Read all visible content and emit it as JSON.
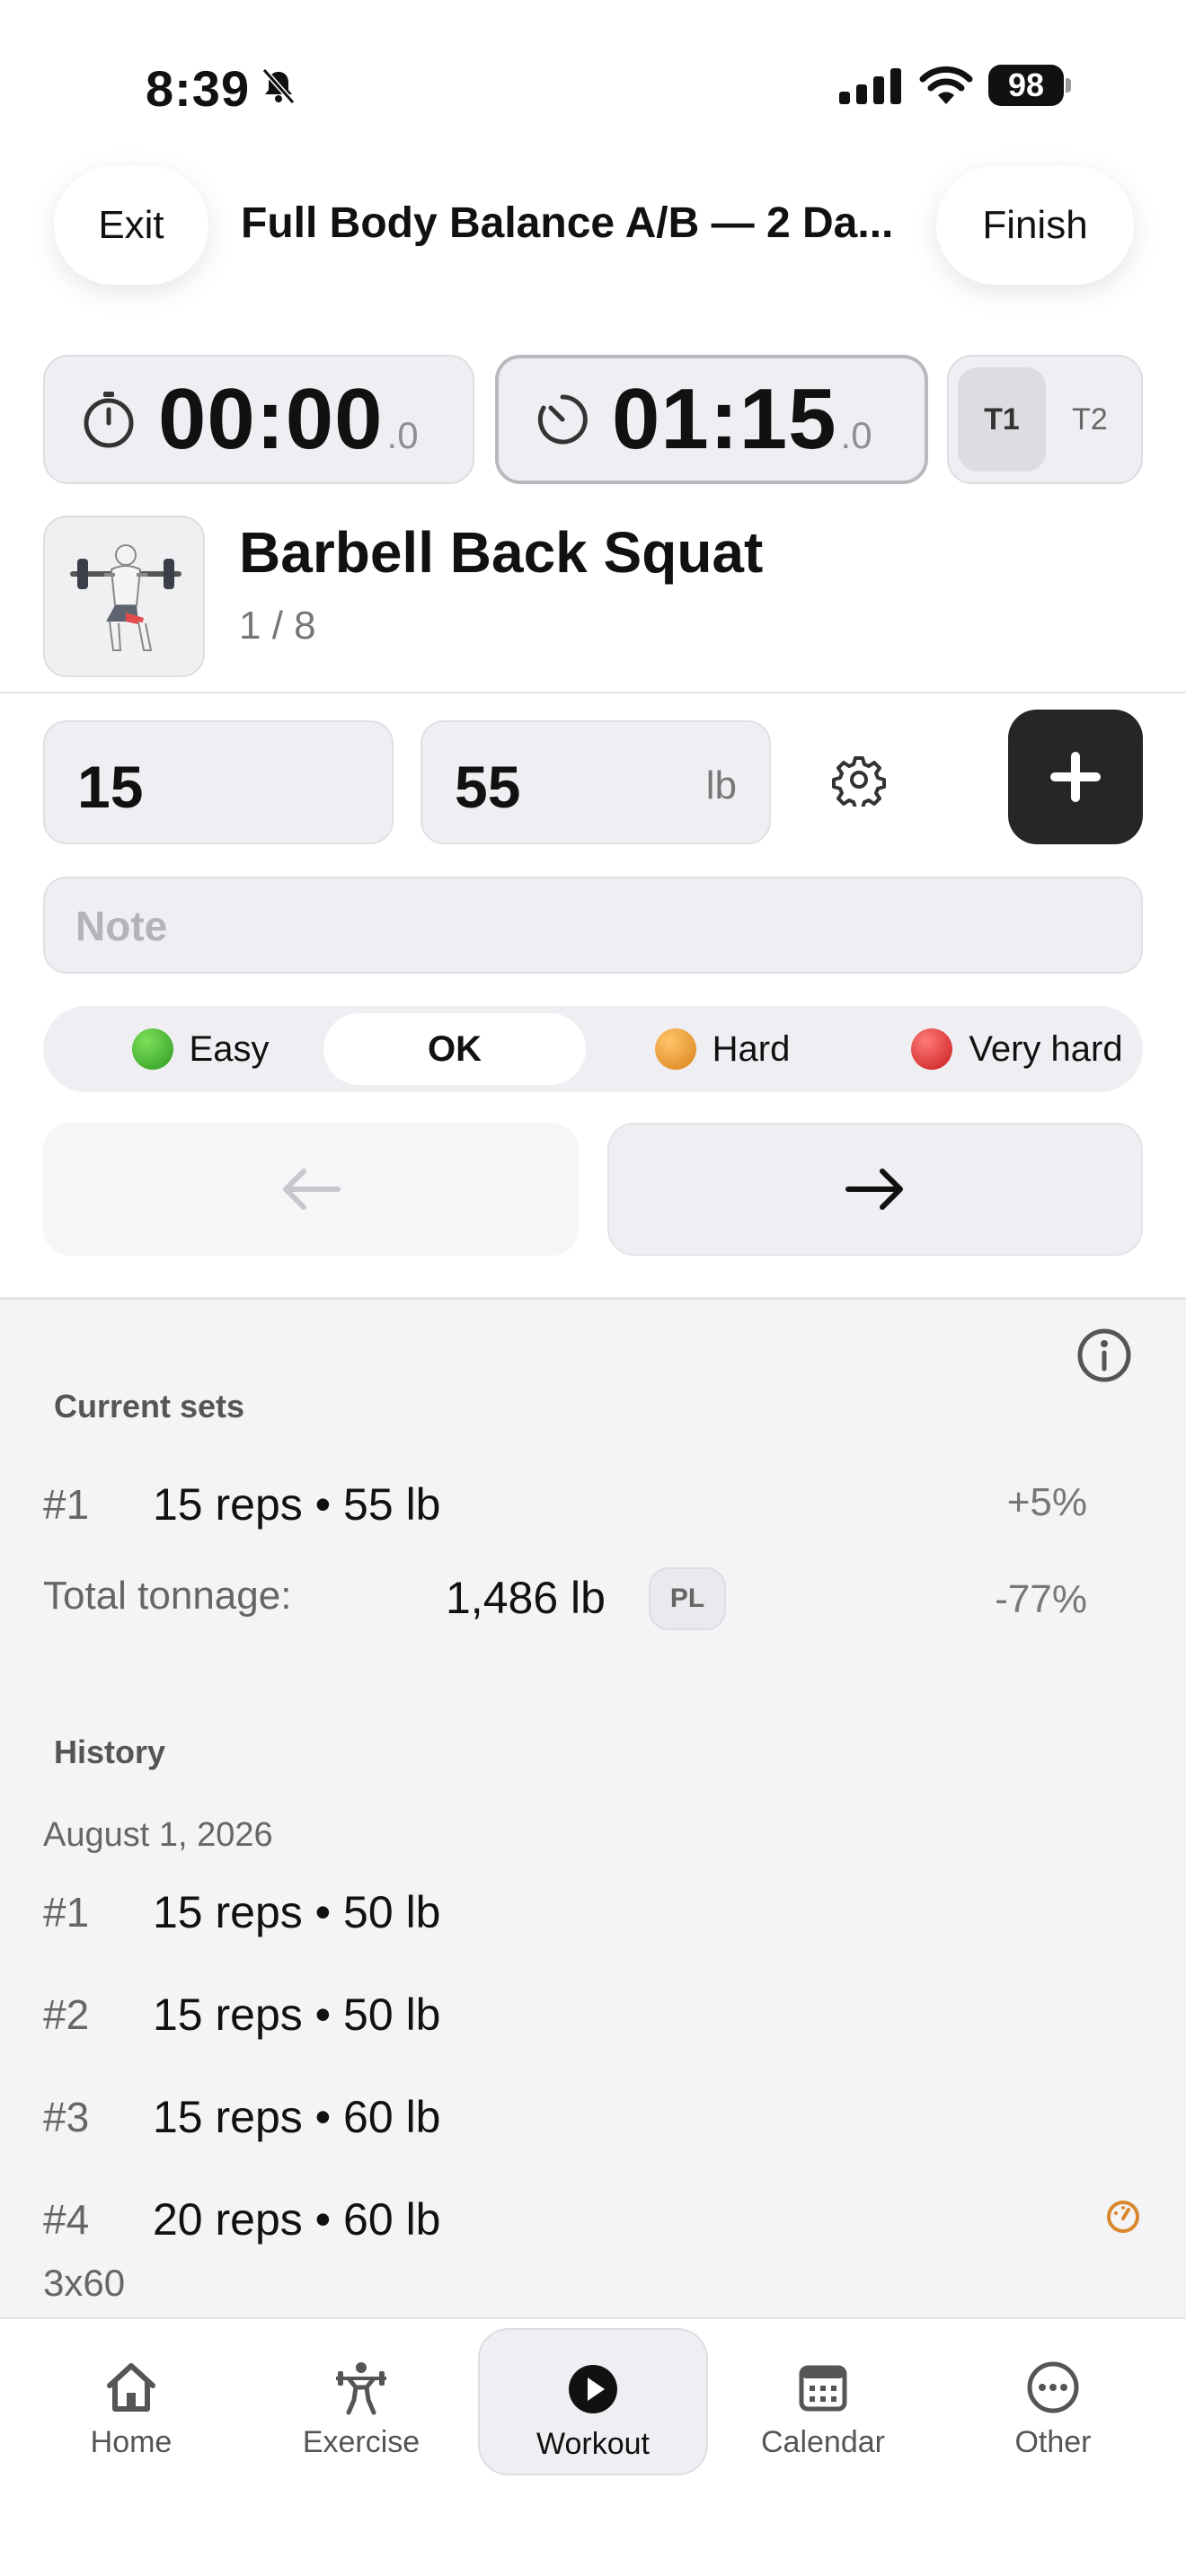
{
  "status_bar": {
    "time": "8:39",
    "battery": "98"
  },
  "header": {
    "exit_label": "Exit",
    "title": "Full Body Balance A/B — 2 Da...",
    "finish_label": "Finish"
  },
  "timers": {
    "elapsed": {
      "main": "00:00",
      "decimal": ".0"
    },
    "rest": {
      "main": "01:15",
      "decimal": ".0"
    },
    "segments": [
      "T1",
      "T2"
    ]
  },
  "exercise": {
    "name": "Barbell Back Squat",
    "progress": "1 / 8"
  },
  "inputs": {
    "reps": "15",
    "weight": "55",
    "unit": "lb",
    "note_placeholder": "Note",
    "note_value": ""
  },
  "difficulty": {
    "selected": "OK",
    "options": [
      {
        "label": "Easy",
        "color": "#3fb62f"
      },
      {
        "label": "OK",
        "color": ""
      },
      {
        "label": "Hard",
        "color": "#f0a030"
      },
      {
        "label": "Very hard",
        "color": "#e02a2a"
      }
    ]
  },
  "current_sets": {
    "label": "Current sets",
    "rows": [
      {
        "num": "#1",
        "value": "15 reps • 55 lb",
        "change": "+5%"
      }
    ],
    "tonnage_label": "Total tonnage:",
    "tonnage_value": "1,486 lb",
    "tonnage_badge": "PL",
    "tonnage_change": "-77%"
  },
  "history": {
    "label": "History",
    "date": "August 1, 2026",
    "rows": [
      {
        "num": "#1",
        "value": "15 reps • 50 lb"
      },
      {
        "num": "#2",
        "value": "15 reps • 50 lb"
      },
      {
        "num": "#3",
        "value": "15 reps • 60 lb"
      },
      {
        "num": "#4",
        "value": "20 reps • 60 lb"
      }
    ],
    "note": "3x60"
  },
  "tabs": [
    {
      "label": "Home"
    },
    {
      "label": "Exercise"
    },
    {
      "label": "Workout"
    },
    {
      "label": "Calendar"
    },
    {
      "label": "Other"
    }
  ],
  "colors": {
    "accent_dark": "#262626",
    "panel": "#efeff3",
    "gauge": "#d9882b"
  }
}
